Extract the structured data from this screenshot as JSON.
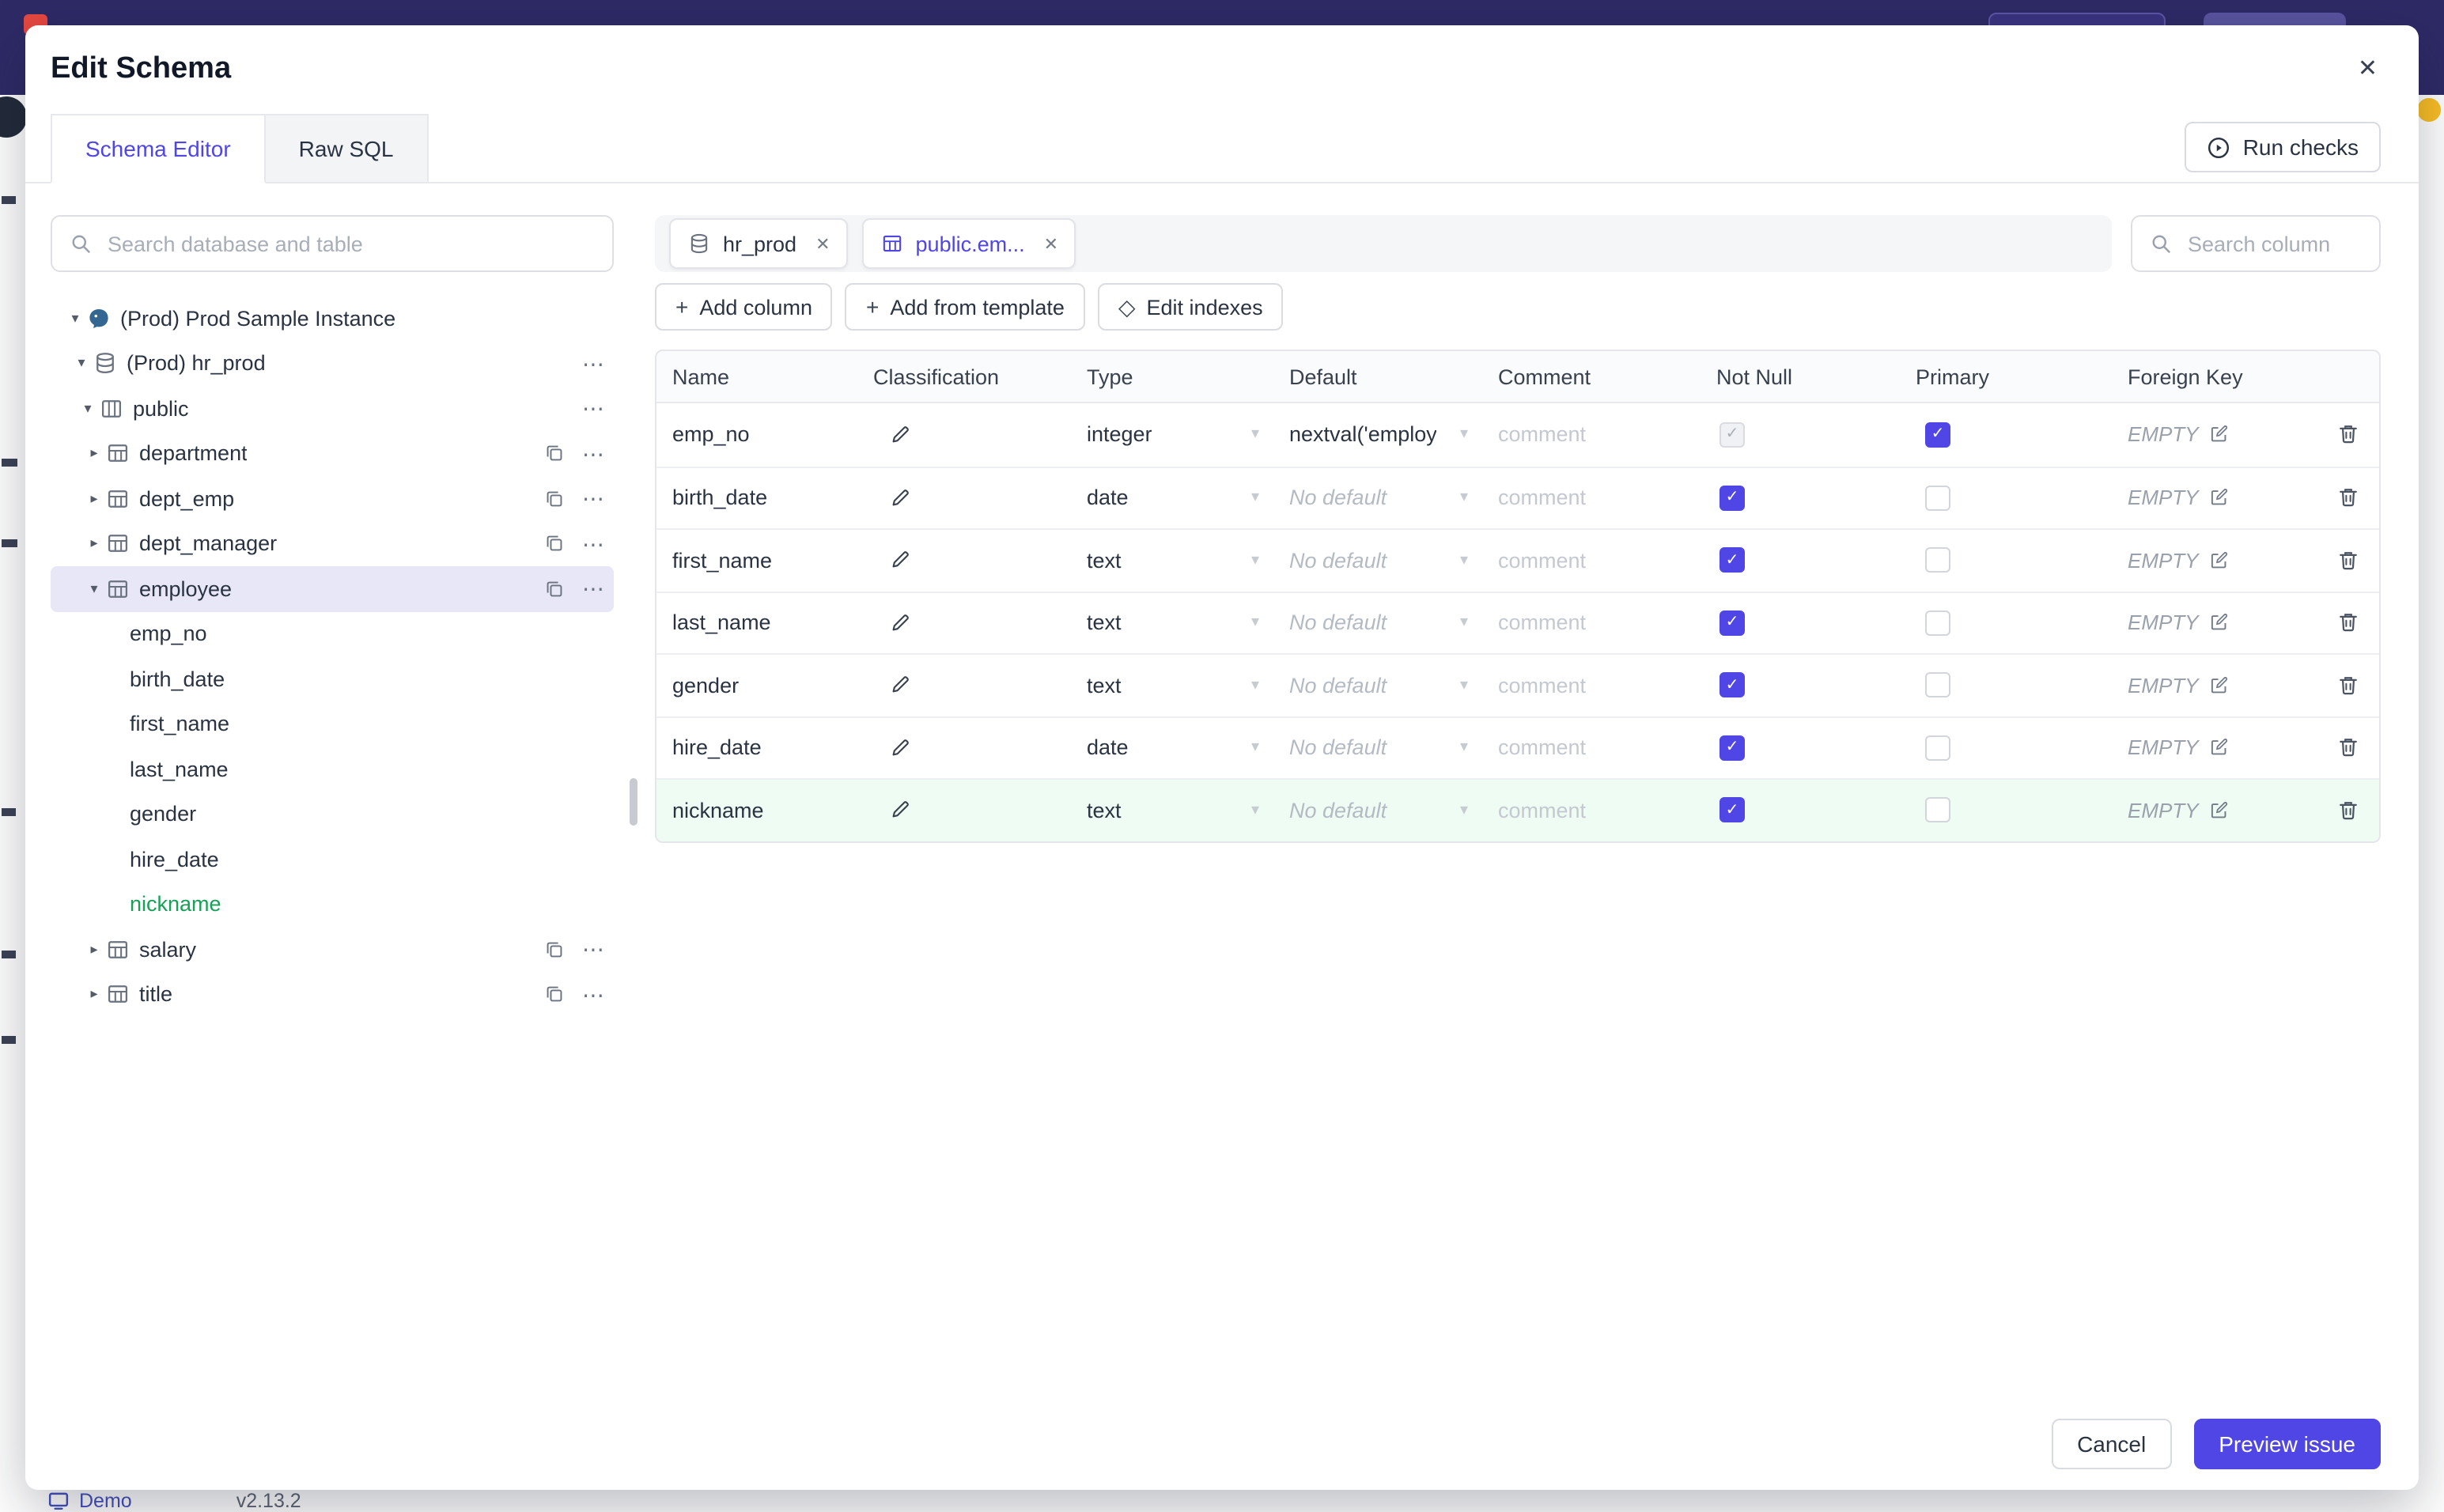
{
  "colors": {
    "primary": "#4f46e5",
    "topbar": "#2e2a66",
    "added_green": "#18a058",
    "added_row_bg": "#eefcf3",
    "notification_dot": "#fbbf24"
  },
  "glyphs": {
    "close": "✕",
    "chip_close": "✕",
    "plus": "+",
    "diamond": "◇",
    "caret_down": "▾",
    "caret_right": "▸",
    "more": "⋯",
    "check": "✓",
    "chevron": "▾"
  },
  "background": {
    "demo_label": "Demo",
    "version": "v2.13.2"
  },
  "modal": {
    "title": "Edit Schema",
    "run_checks": "Run checks",
    "tabs": [
      {
        "label": "Schema Editor",
        "active": true
      },
      {
        "label": "Raw SQL",
        "active": false
      }
    ],
    "sidebar": {
      "search_placeholder": "Search database and table",
      "tree": [
        {
          "label": "(Prod) Prod Sample Instance",
          "level": 0,
          "caret": "down",
          "icon": "instance"
        },
        {
          "label": "(Prod) hr_prod",
          "level": 1,
          "caret": "down",
          "icon": "database",
          "more": true
        },
        {
          "label": "public",
          "level": 2,
          "caret": "down",
          "icon": "schema",
          "more": true
        },
        {
          "label": "department",
          "level": 3,
          "caret": "right",
          "icon": "table",
          "copy": true,
          "more": true
        },
        {
          "label": "dept_emp",
          "level": 3,
          "caret": "right",
          "icon": "table",
          "copy": true,
          "more": true
        },
        {
          "label": "dept_manager",
          "level": 3,
          "caret": "right",
          "icon": "table",
          "copy": true,
          "more": true
        },
        {
          "label": "employee",
          "level": 3,
          "caret": "down",
          "icon": "table",
          "copy": true,
          "more": true,
          "selected": true
        },
        {
          "label": "emp_no",
          "level": 4,
          "column": true
        },
        {
          "label": "birth_date",
          "level": 4,
          "column": true
        },
        {
          "label": "first_name",
          "level": 4,
          "column": true
        },
        {
          "label": "last_name",
          "level": 4,
          "column": true
        },
        {
          "label": "gender",
          "level": 4,
          "column": true
        },
        {
          "label": "hire_date",
          "level": 4,
          "column": true
        },
        {
          "label": "nickname",
          "level": 4,
          "column": true,
          "added": true
        },
        {
          "label": "salary",
          "level": 3,
          "caret": "right",
          "icon": "table",
          "copy": true,
          "more": true
        },
        {
          "label": "title",
          "level": 3,
          "caret": "right",
          "icon": "table",
          "copy": true,
          "more": true
        }
      ]
    },
    "editor": {
      "tabs": [
        {
          "label": "hr_prod",
          "icon": "database",
          "active": false
        },
        {
          "label": "public.em...",
          "icon": "table",
          "active": true
        }
      ],
      "search_placeholder": "Search column",
      "toolbar": [
        {
          "label": "Add column",
          "icon": "plus"
        },
        {
          "label": "Add from template",
          "icon": "plus"
        },
        {
          "label": "Edit indexes",
          "icon": "diamond"
        }
      ],
      "columns_table": {
        "headers": [
          "Name",
          "Classification",
          "Type",
          "Default",
          "Comment",
          "Not Null",
          "Primary",
          "Foreign Key",
          ""
        ],
        "comment_placeholder": "comment",
        "foreign_key_empty": "EMPTY",
        "rows": [
          {
            "name": "emp_no",
            "type": "integer",
            "default": "nextval('employ",
            "has_default": true,
            "not_null": "checked-disabled",
            "primary": "checked",
            "highlight": false
          },
          {
            "name": "birth_date",
            "type": "date",
            "default": "No default",
            "has_default": false,
            "not_null": "checked",
            "primary": "unchecked",
            "highlight": false
          },
          {
            "name": "first_name",
            "type": "text",
            "default": "No default",
            "has_default": false,
            "not_null": "checked",
            "primary": "unchecked",
            "highlight": false
          },
          {
            "name": "last_name",
            "type": "text",
            "default": "No default",
            "has_default": false,
            "not_null": "checked",
            "primary": "unchecked",
            "highlight": false
          },
          {
            "name": "gender",
            "type": "text",
            "default": "No default",
            "has_default": false,
            "not_null": "checked",
            "primary": "unchecked",
            "highlight": false
          },
          {
            "name": "hire_date",
            "type": "date",
            "default": "No default",
            "has_default": false,
            "not_null": "checked",
            "primary": "unchecked",
            "highlight": false
          },
          {
            "name": "nickname",
            "type": "text",
            "default": "No default",
            "has_default": false,
            "not_null": "checked",
            "primary": "unchecked",
            "highlight": true
          }
        ]
      }
    },
    "footer": {
      "cancel": "Cancel",
      "preview": "Preview issue"
    }
  }
}
